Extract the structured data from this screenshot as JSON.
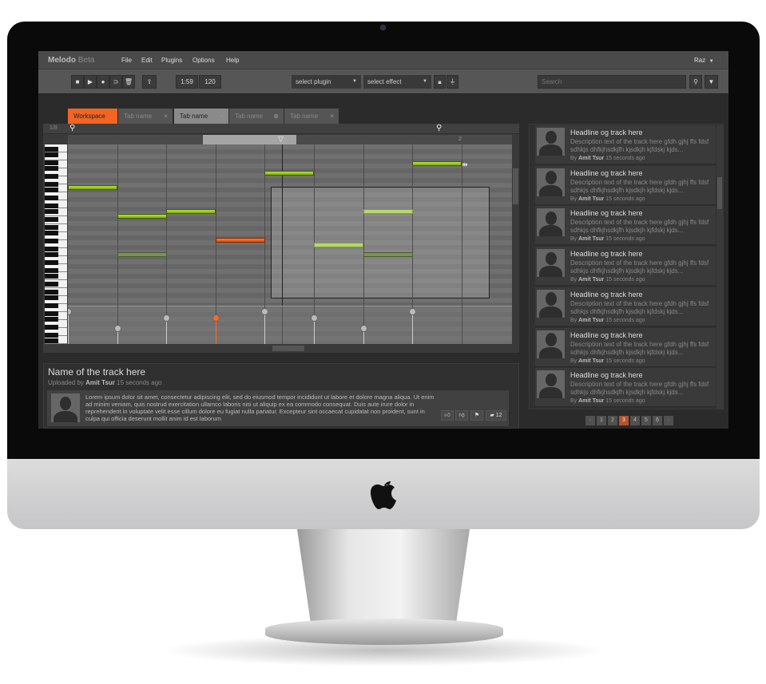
{
  "app": {
    "name": "Melodo",
    "badge": "Beta",
    "user": "Raz",
    "accent": "#f26522"
  },
  "menu": [
    "File",
    "Edit",
    "Plugins",
    "Options",
    "Help"
  ],
  "toolbar": {
    "time": "1:59",
    "tempo": "120",
    "plugin": "select plugin",
    "effect": "select effect",
    "search_placeholder": "Search",
    "transport": [
      {
        "icon": "stop-icon",
        "g": "■"
      },
      {
        "icon": "play-icon",
        "g": "▶"
      },
      {
        "icon": "record-icon",
        "g": "●"
      },
      {
        "icon": "loop-icon",
        "g": "⊃"
      },
      {
        "icon": "trash-icon",
        "g": "🗑"
      }
    ]
  },
  "tabs": [
    {
      "label": "Workspace",
      "state": "active"
    },
    {
      "label": "Tab name",
      "close": "×"
    },
    {
      "label": "Tab name",
      "close": "×",
      "state": "selected"
    },
    {
      "label": "Tab name",
      "close": "⊗"
    },
    {
      "label": "Tab name",
      "close": "×"
    }
  ],
  "roll": {
    "quantize": "1/8",
    "bar_marker": "2",
    "steps": 9,
    "notes": [
      {
        "step": 0,
        "row": 9,
        "state": "normal"
      },
      {
        "step": 1,
        "row": 15,
        "state": "normal"
      },
      {
        "step": 2,
        "row": 14,
        "state": "normal"
      },
      {
        "step": 3,
        "row": 20,
        "state": "active"
      },
      {
        "step": 4,
        "row": 6,
        "state": "normal"
      },
      {
        "step": 7,
        "row": 4,
        "state": "normal"
      },
      {
        "step": 5,
        "row": 21,
        "state": "selected"
      },
      {
        "step": 6,
        "row": 14,
        "state": "selected"
      },
      {
        "step": 6,
        "row": 23,
        "state": "faded"
      },
      {
        "step": 1,
        "row": 23,
        "state": "faded"
      }
    ],
    "velocity": [
      0.9,
      0.44,
      0.72,
      0.72,
      0.9,
      0.72,
      0.44,
      0.9
    ],
    "velocity_active": 3
  },
  "track": {
    "title": "Name of the track here",
    "uploaded_prefix": "Uploaded by",
    "author": "Amit Tsur",
    "time": "15 seconds ago",
    "comment": "Lorem ipsum dolor sit amet, consectetur adipiscing elit, sed do eiusmod tempor incididunt ut labore et dolore magna aliqua. Ut enim ad minim veniam, quis nostrud exercitation ullamco laboris nisi ut aliquip ex ea commodo consequat. Duis aute irure dolor in reprehenderit in voluptate velit esse cillum dolore eu fugiat nulla pariatur. Excepteur sint occaecat cupidatat non proident, sunt in culpa qui officia deserunt mollit anim id est laborum",
    "comments_count": "12"
  },
  "feed": [
    {
      "headline": "Headline og track here",
      "desc": "Description text of the track here gfdh gjhj ffs fdsf sdhkjs dhfkjhsdkjfh kjsdkjh kjfdskj kjds...",
      "by": "By",
      "author": "Amit Tsur",
      "time": "15 seconds ago"
    },
    {
      "headline": "Headline og track here",
      "desc": "Description text of the track here gfdh gjhj ffs fdsf sdhkjs dhfkjhsdkjfh kjsdkjh kjfdskj kjds...",
      "by": "By",
      "author": "Amit Tsur",
      "time": "15 seconds ago"
    },
    {
      "headline": "Headline og track here",
      "desc": "Description text of the track here gfdh gjhj ffs fdsf sdhkjs dhfkjhsdkjfh kjsdkjh kjfdskj kjds...",
      "by": "By",
      "author": "Amit Tsur",
      "time": "15 seconds ago"
    },
    {
      "headline": "Headline og track here",
      "desc": "Description text of the track here gfdh gjhj ffs fdsf sdhkjs dhfkjhsdkjfh kjsdkjh kjfdskj kjds...",
      "by": "By",
      "author": "Amit Tsur",
      "time": "15 seconds ago"
    },
    {
      "headline": "Headline og track here",
      "desc": "Description text of the track here gfdh gjhj ffs fdsf sdhkjs dhfkjhsdkjfh kjsdkjh kjfdskj kjds...",
      "by": "By",
      "author": "Amit Tsur",
      "time": "15 seconds ago"
    },
    {
      "headline": "Headline og track here",
      "desc": "Description text of the track here gfdh gjhj ffs fdsf sdhkjs dhfkjhsdkjfh kjsdkjh kjfdskj kjds...",
      "by": "By",
      "author": "Amit Tsur",
      "time": "15 seconds ago"
    },
    {
      "headline": "Headline og track here",
      "desc": "Description text of the track here gfdh gjhj ffs fdsf sdhkjs dhfkjhsdkjfh kjsdkjh kjfdskj kjds...",
      "by": "By",
      "author": "Amit Tsur",
      "time": "15 seconds ago"
    }
  ],
  "pagination": {
    "prev": "‹",
    "next": "›",
    "pages": [
      "1",
      "2",
      "3",
      "4",
      "5",
      "6"
    ],
    "current": "3"
  }
}
